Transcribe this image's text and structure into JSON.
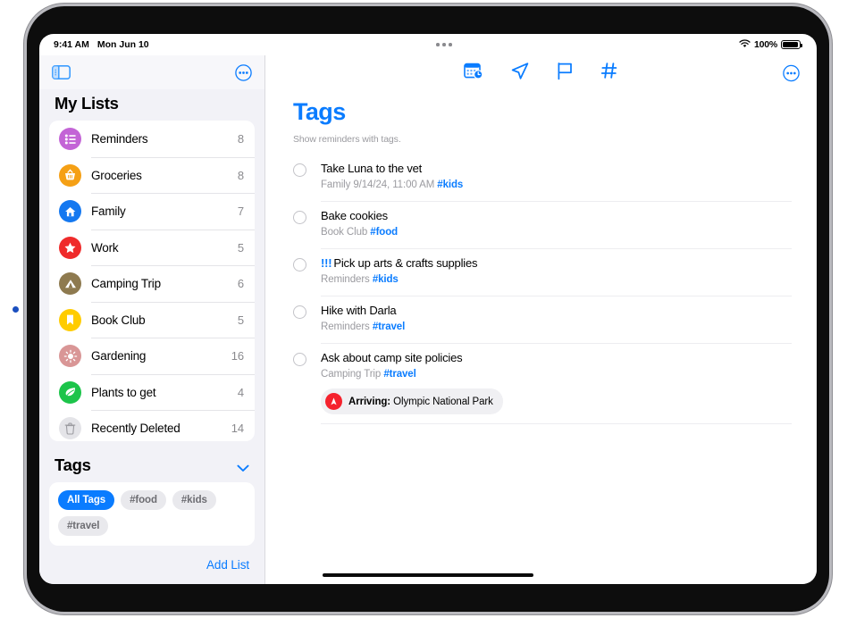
{
  "status_bar": {
    "time": "9:41 AM",
    "date": "Mon Jun 10",
    "wifi_icon": "wifi-icon",
    "battery_percent": "100%",
    "multitask_icon": "multitasking-dots-icon"
  },
  "sidebar": {
    "toggle_icon": "sidebar-toggle-icon",
    "more_icon": "circled-ellipsis-icon",
    "my_lists_title": "My Lists",
    "lists": [
      {
        "label": "Reminders",
        "count": "8",
        "icon": "list-bullet-icon",
        "color": "#c364d6"
      },
      {
        "label": "Groceries",
        "count": "8",
        "icon": "basket-icon",
        "color": "#f5a015"
      },
      {
        "label": "Family",
        "count": "7",
        "icon": "house-icon",
        "color": "#1478f0"
      },
      {
        "label": "Work",
        "count": "5",
        "icon": "star-icon",
        "color": "#ef2b2b"
      },
      {
        "label": "Camping Trip",
        "count": "6",
        "icon": "tent-icon",
        "color": "#8e7a4f"
      },
      {
        "label": "Book Club",
        "count": "5",
        "icon": "bookmark-icon",
        "color": "#ffcc00"
      },
      {
        "label": "Gardening",
        "count": "16",
        "icon": "sun-icon",
        "color": "#d99696"
      },
      {
        "label": "Plants to get",
        "count": "4",
        "icon": "leaf-icon",
        "color": "#1cc44a"
      },
      {
        "label": "Recently Deleted",
        "count": "14",
        "icon": "trash-icon",
        "color": "#e4e4e8"
      }
    ],
    "tags_title": "Tags",
    "tags_chevron_icon": "chevron-down-icon",
    "tag_chips": [
      {
        "label": "All Tags",
        "selected": true
      },
      {
        "label": "#food",
        "selected": false
      },
      {
        "label": "#kids",
        "selected": false
      },
      {
        "label": "#travel",
        "selected": false
      }
    ],
    "add_list_label": "Add List"
  },
  "main": {
    "smart_icons": [
      {
        "name": "scheduled-calendar-icon"
      },
      {
        "name": "location-arrow-icon"
      },
      {
        "name": "flag-icon"
      },
      {
        "name": "hashtag-icon"
      }
    ],
    "more_icon": "circled-ellipsis-icon",
    "title": "Tags",
    "subtitle": "Show reminders with tags.",
    "reminders": [
      {
        "priority": "",
        "title": "Take Luna to the vet",
        "list": "Family",
        "date": "9/14/24, 11:00 AM",
        "tag": "#kids",
        "location_badge": null
      },
      {
        "priority": "",
        "title": "Bake cookies",
        "list": "Book Club",
        "date": "",
        "tag": "#food",
        "location_badge": null
      },
      {
        "priority": "!!!",
        "title": "Pick up arts & crafts supplies",
        "list": "Reminders",
        "date": "",
        "tag": "#kids",
        "location_badge": null
      },
      {
        "priority": "",
        "title": "Hike with Darla",
        "list": "Reminders",
        "date": "",
        "tag": "#travel",
        "location_badge": null
      },
      {
        "priority": "",
        "title": "Ask about camp site policies",
        "list": "Camping Trip",
        "date": "",
        "tag": "#travel",
        "location_badge": {
          "label": "Arriving:",
          "value": "Olympic National Park",
          "icon": "location-pin-icon"
        }
      }
    ]
  },
  "colors": {
    "accent": "#0a7cff",
    "sidebar_bg": "#f2f2f7",
    "alert_red": "#f5222d"
  }
}
